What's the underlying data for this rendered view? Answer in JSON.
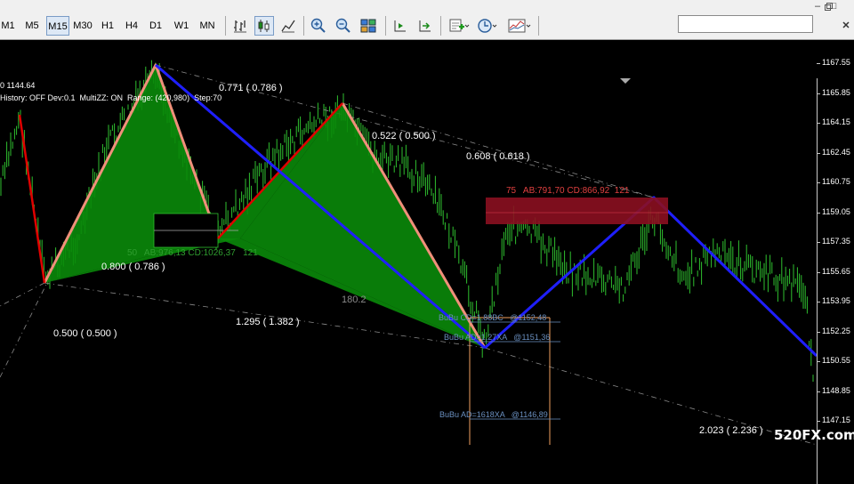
{
  "toolbar": {
    "timeframes": [
      {
        "label": "M1",
        "active": false
      },
      {
        "label": "M5",
        "active": false
      },
      {
        "label": "M15",
        "active": true
      },
      {
        "label": "M30",
        "active": false
      },
      {
        "label": "H1",
        "active": false
      },
      {
        "label": "H4",
        "active": false
      },
      {
        "label": "D1",
        "active": false
      },
      {
        "label": "W1",
        "active": false
      },
      {
        "label": "MN",
        "active": false
      }
    ],
    "icons": [
      "bar-chart-icon",
      "candlestick-chart-icon",
      "line-chart-icon",
      "zoom-in-icon",
      "zoom-out-icon",
      "tile-windows-icon",
      "chart-shift-icon",
      "autoscroll-icon",
      "indicators-icon",
      "periods-clock-icon",
      "templates-icon"
    ],
    "search_placeholder": ""
  },
  "chart": {
    "header_line1": "0 1144.64",
    "header_line2": "History: OFF Dev:0.1  MultiZZ: ON  Range: (420,980)  Step:70",
    "price_ticks": [
      "1167.55",
      "1165.85",
      "1164.15",
      "1162.45",
      "1160.75",
      "1159.05",
      "1157.35",
      "1155.65",
      "1153.95",
      "1152.25",
      "1150.55",
      "1148.85",
      "1147.15"
    ],
    "fib_labels": {
      "f1": "0.771 ( 0.786 )",
      "f2": "0.522 ( 0.500 )",
      "f3": "0.608 ( 0.618 )",
      "f4": "0.800 ( 0.786 )",
      "f5": "1.295 ( 1.382 )",
      "f6": "0.500 ( 0.500 )",
      "f7": "2.023 ( 2.236 )"
    },
    "pattern_label_red": "75   AB:791,70 CD:866,92  121",
    "pattern_label_green": "50   AB:976,13 CD:1026,37   121",
    "gray_label": "180.2",
    "bubu_labels": {
      "b1": "BuBu CD=1.88BC   @1152,48",
      "b2": "BuBu AD=1.27XA   @1151,36",
      "b3": "BuBu AD=1618XA   @1146,89"
    },
    "watermark": "520FX.com",
    "colors": {
      "candles": "#2fbf2f",
      "pattern_fill": "#0a8a0a",
      "zigzag_blue": "#1f1fff",
      "zigzag_red": "#e00000",
      "pattern_edge": "#f0907a",
      "red_zone": "#8b1020"
    }
  }
}
